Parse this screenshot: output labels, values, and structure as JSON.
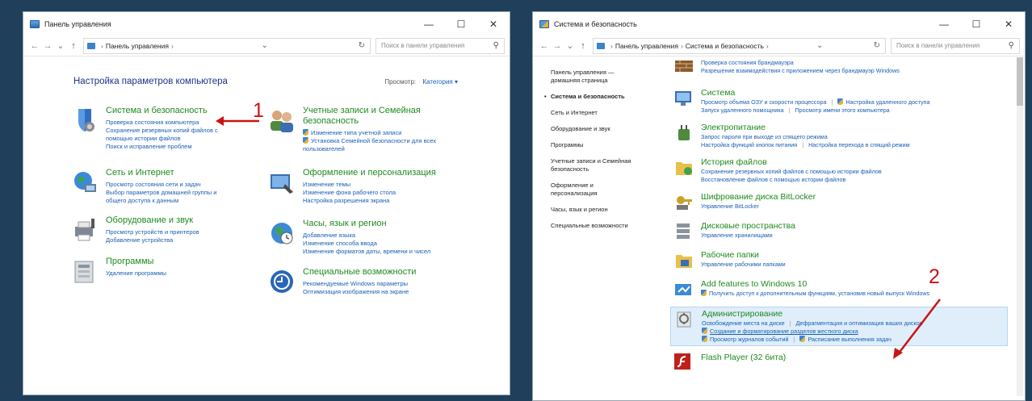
{
  "left_window": {
    "title": "Панель управления",
    "controls": {
      "minimize": "—",
      "maximize": "☐",
      "close": "✕"
    },
    "address": {
      "crumb": "Панель управления",
      "sep": "›",
      "sep_end": "›",
      "dropdown": "⌄",
      "refresh": "↻"
    },
    "search_placeholder": "Поиск в панели управления",
    "header": "Настройка параметров компьютера",
    "view_by_label": "Просмотр:",
    "view_by_value": "Категория ▾",
    "categories": [
      {
        "title": "Система и безопасность",
        "links": [
          "Проверка состояния компьютера",
          "Сохранение резервных копий файлов с помощью истории файлов",
          "Поиск и исправление проблем"
        ]
      },
      {
        "title": "Сеть и Интернет",
        "links": [
          "Просмотр состояния сети и задач",
          "Выбор параметров домашней группы и общего доступа к данным"
        ]
      },
      {
        "title": "Оборудование и звук",
        "links": [
          "Просмотр устройств и принтеров",
          "Добавление устройства"
        ]
      },
      {
        "title": "Программы",
        "links": [
          "Удаление программы"
        ]
      },
      {
        "title": "Учетные записи и Семейная безопасность",
        "links": [
          "Изменение типа учетной записи",
          "Установка Семейной безопасности для всех пользователей"
        ]
      },
      {
        "title": "Оформление и персонализация",
        "links": [
          "Изменение темы",
          "Изменение фона рабочего стола",
          "Настройка разрешения экрана"
        ]
      },
      {
        "title": "Часы, язык и регион",
        "links": [
          "Добавление языка",
          "Изменение способа ввода",
          "Изменение форматов даты, времени и чисел"
        ]
      },
      {
        "title": "Специальные возможности",
        "links": [
          "Рекомендуемые Windows параметры",
          "Оптимизация изображения на экране"
        ]
      }
    ],
    "annotation": "1"
  },
  "right_window": {
    "title": "Система и безопасность",
    "controls": {
      "minimize": "—",
      "maximize": "☐",
      "close": "✕"
    },
    "address": {
      "crumb1": "Панель управления",
      "crumb2": "Система и безопасность",
      "sep": "›",
      "sep_end": "›",
      "dropdown": "⌄",
      "refresh": "↻"
    },
    "search_placeholder": "Поиск в панели управления",
    "sidebar": [
      "Панель управления — домашняя страница",
      "Система и безопасность",
      "Сеть и Интернет",
      "Оборудование и звук",
      "Программы",
      "Учетные записи и Семейная безопасность",
      "Оформление и персонализация",
      "Часы, язык и регион",
      "Специальные возможности"
    ],
    "items": [
      {
        "title": "",
        "links": [
          "Проверка состояния брандмауэра",
          "Разрешение взаимодействия с приложением через брандмауэр Windows"
        ]
      },
      {
        "title": "Система",
        "links": [
          "Просмотр объема ОЗУ и скорости процессора",
          "Настройка удаленного доступа",
          "Запуск удаленного помощника",
          "Просмотр имени этого компьютера"
        ]
      },
      {
        "title": "Электропитание",
        "links": [
          "Запрос пароля при выходе из спящего режима",
          "Настройка функций кнопок питания",
          "Настройка перехода в спящий режим"
        ]
      },
      {
        "title": "История файлов",
        "links": [
          "Сохранение резервных копий файлов с помощью истории файлов",
          "Восстановление файлов с помощью истории файлов"
        ]
      },
      {
        "title": "Шифрование диска BitLocker",
        "links": [
          "Управление BitLocker"
        ]
      },
      {
        "title": "Дисковые пространства",
        "links": [
          "Управление хранилищами"
        ]
      },
      {
        "title": "Рабочие папки",
        "links": [
          "Управление рабочими папками"
        ]
      },
      {
        "title": "Add features to Windows 10",
        "links": [
          "Получить доступ к дополнительным функциям, установив новый выпуск Windows"
        ]
      },
      {
        "title": "Администрирование",
        "links": [
          "Освобождение места на диске",
          "Дефрагментация и оптимизация ваших дисков",
          "Создание и форматирование разделов жесткого диска",
          "Просмотр журналов событий",
          "Расписание выполнения задач"
        ]
      },
      {
        "title": "Flash Player (32 бита)",
        "links": []
      }
    ],
    "annotation": "2"
  },
  "colors": {
    "link": "#1a5fb4",
    "category": "#1e8a1e",
    "annotation": "#c81414",
    "highlight": "#dfeefa"
  }
}
